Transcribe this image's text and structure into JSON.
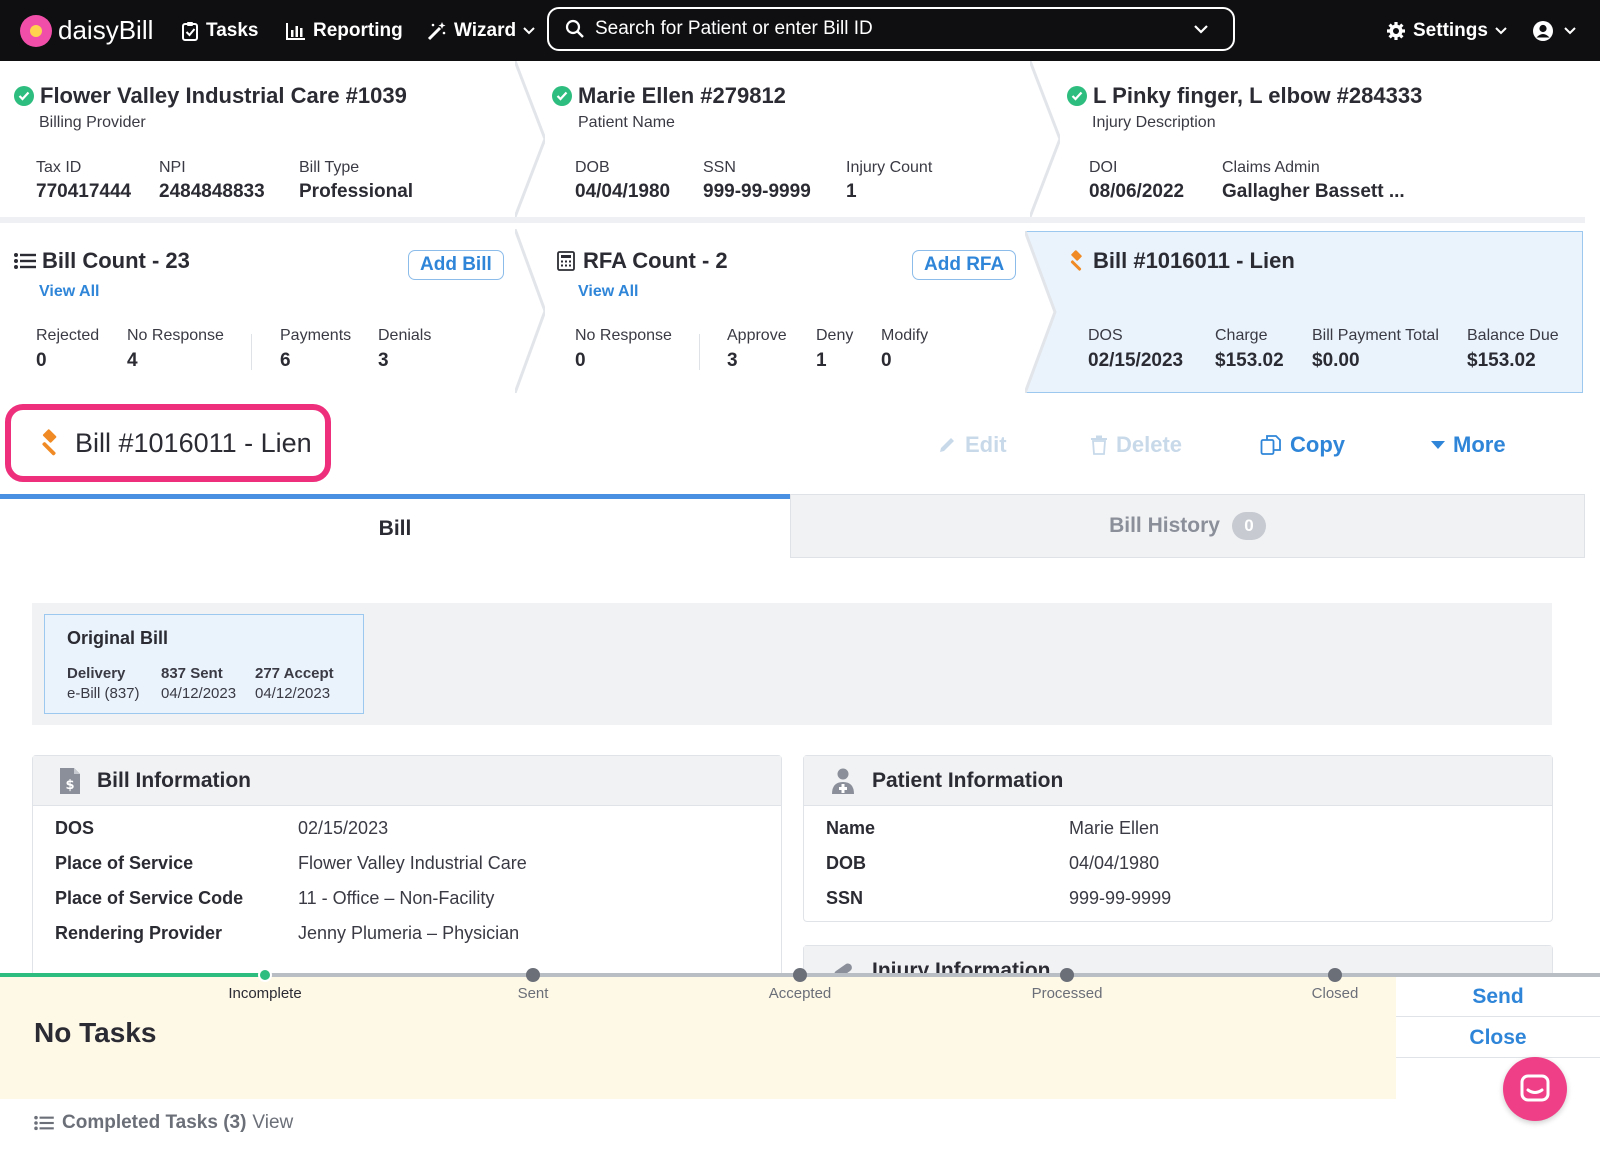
{
  "nav": {
    "logo": "daisyBill",
    "tasks": "Tasks",
    "reporting": "Reporting",
    "wizard": "Wizard",
    "search_placeholder": "Search for Patient or enter Bill ID",
    "settings": "Settings"
  },
  "provider": {
    "title": "Flower Valley Industrial Care #1039",
    "subtitle": "Billing Provider",
    "tax_id_label": "Tax ID",
    "tax_id": "770417444",
    "npi_label": "NPI",
    "npi": "2484848833",
    "bill_type_label": "Bill Type",
    "bill_type": "Professional"
  },
  "patient": {
    "title": "Marie Ellen #279812",
    "subtitle": "Patient Name",
    "dob_label": "DOB",
    "dob": "04/04/1980",
    "ssn_label": "SSN",
    "ssn": "999-99-9999",
    "injury_count_label": "Injury Count",
    "injury_count": "1"
  },
  "injury": {
    "title": "L Pinky finger, L elbow #284333",
    "subtitle": "Injury Description",
    "doi_label": "DOI",
    "doi": "08/06/2022",
    "claims_admin_label": "Claims Admin",
    "claims_admin": "Gallagher Bassett ..."
  },
  "bill_count": {
    "title": "Bill Count - 23",
    "view_all": "View All",
    "add": "Add Bill",
    "stats": [
      {
        "label": "Rejected",
        "value": "0"
      },
      {
        "label": "No Response",
        "value": "4"
      },
      {
        "label": "Payments",
        "value": "6"
      },
      {
        "label": "Denials",
        "value": "3"
      }
    ]
  },
  "rfa_count": {
    "title": "RFA Count - 2",
    "view_all": "View All",
    "add": "Add RFA",
    "stats": [
      {
        "label": "No Response",
        "value": "0"
      },
      {
        "label": "Approve",
        "value": "3"
      },
      {
        "label": "Deny",
        "value": "1"
      },
      {
        "label": "Modify",
        "value": "0"
      }
    ]
  },
  "current_bill": {
    "title": "Bill #1016011 - Lien",
    "stats": [
      {
        "label": "DOS",
        "value": "02/15/2023"
      },
      {
        "label": "Charge",
        "value": "$153.02"
      },
      {
        "label": "Bill Payment Total",
        "value": "$0.00"
      },
      {
        "label": "Balance Due",
        "value": "$153.02"
      }
    ]
  },
  "bill_header": {
    "title": "Bill #1016011 - Lien",
    "edit": "Edit",
    "delete": "Delete",
    "copy": "Copy",
    "more": "More"
  },
  "tabs": {
    "bill": "Bill",
    "history": "Bill History",
    "history_count": "0"
  },
  "original_bill": {
    "title": "Original Bill",
    "delivery_label": "Delivery",
    "delivery": "e-Bill (837)",
    "sent_label": "837 Sent",
    "sent": "04/12/2023",
    "accept_label": "277 Accept",
    "accept": "04/12/2023"
  },
  "bill_info": {
    "title": "Bill Information",
    "rows": [
      {
        "key": "DOS",
        "value": "02/15/2023"
      },
      {
        "key": "Place of Service",
        "value": "Flower Valley Industrial Care"
      },
      {
        "key": "Place of Service Code",
        "value": "11 - Office – Non-Facility"
      },
      {
        "key": "Rendering Provider",
        "value": "Jenny Plumeria – Physician"
      }
    ]
  },
  "patient_info": {
    "title": "Patient Information",
    "rows": [
      {
        "key": "Name",
        "value": "Marie Ellen"
      },
      {
        "key": "DOB",
        "value": "04/04/1980"
      },
      {
        "key": "SSN",
        "value": "999-99-9999"
      }
    ]
  },
  "injury_info": {
    "title": "Injury Information"
  },
  "progress": {
    "steps": [
      "Incomplete",
      "Sent",
      "Accepted",
      "Processed",
      "Closed"
    ],
    "current": 0
  },
  "tasks": {
    "empty": "No Tasks",
    "send": "Send",
    "close": "Close",
    "completed_label": "Completed Tasks (3)",
    "completed_view": "View"
  },
  "colors": {
    "accent": "#2f86d9",
    "success": "#2dbd7e",
    "highlight": "#ee2f7c",
    "lien_icon": "#f08a24",
    "tasks_bg": "#fef8e7"
  }
}
